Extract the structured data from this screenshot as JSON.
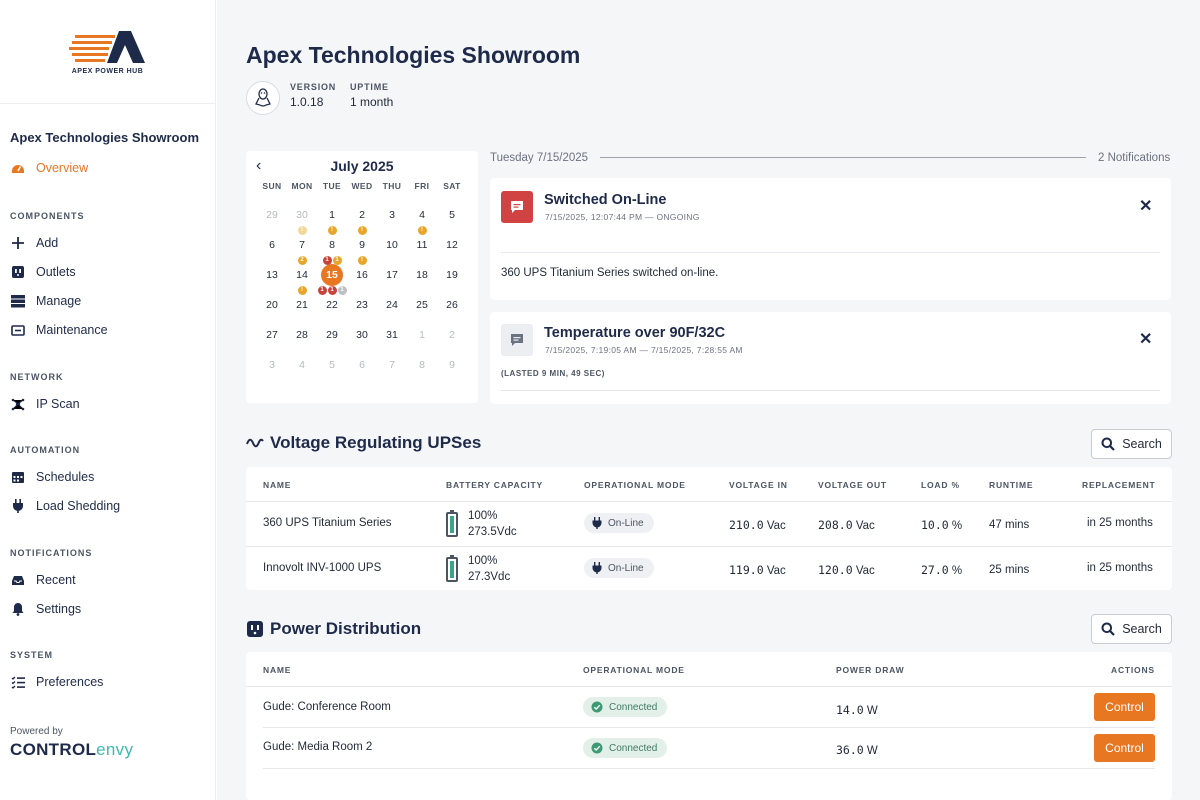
{
  "brand": {
    "logo_text": "APEX POWER HUB",
    "powered_by": "Powered by",
    "vendor_part1": "CONTROL",
    "vendor_part2": "envy",
    "accent_color": "#e87722"
  },
  "sidebar": {
    "site_name": "Apex Technologies Showroom",
    "overview": "Overview",
    "sections": {
      "components": "COMPONENTS",
      "network": "NETWORK",
      "automation": "AUTOMATION",
      "notifications": "NOTIFICATIONS",
      "system": "SYSTEM"
    },
    "items": {
      "add": "Add",
      "outlets": "Outlets",
      "manage": "Manage",
      "maintenance": "Maintenance",
      "ip_scan": "IP Scan",
      "schedules": "Schedules",
      "load_shedding": "Load Shedding",
      "recent": "Recent",
      "settings": "Settings",
      "preferences": "Preferences"
    }
  },
  "header": {
    "title": "Apex Technologies Showroom",
    "os_icon": "linux-icon",
    "version_label": "VERSION",
    "version": "1.0.18",
    "uptime_label": "UPTIME",
    "uptime": "1 month"
  },
  "calendar": {
    "month": "July 2025",
    "days_of_week": [
      "SUN",
      "MON",
      "TUE",
      "WED",
      "THU",
      "FRI",
      "SAT"
    ],
    "weeks": [
      [
        "29",
        "30",
        "1",
        "2",
        "3",
        "4",
        "5"
      ],
      [
        "6",
        "7",
        "8",
        "9",
        "10",
        "11",
        "12"
      ],
      [
        "13",
        "14",
        "15",
        "16",
        "17",
        "18",
        "19"
      ],
      [
        "20",
        "21",
        "22",
        "23",
        "24",
        "25",
        "26"
      ],
      [
        "27",
        "28",
        "29",
        "30",
        "31",
        "1",
        "2"
      ],
      [
        "3",
        "4",
        "5",
        "6",
        "7",
        "8",
        "9"
      ]
    ],
    "selected_day": "15",
    "markers": [
      {
        "week": 0,
        "day": 1,
        "dots": [
          {
            "color": "ly",
            "text": "!"
          }
        ]
      },
      {
        "week": 0,
        "day": 2,
        "dots": [
          {
            "color": "y",
            "text": "!"
          }
        ]
      },
      {
        "week": 0,
        "day": 3,
        "dots": [
          {
            "color": "y",
            "text": "!"
          }
        ]
      },
      {
        "week": 0,
        "day": 5,
        "dots": [
          {
            "color": "y",
            "text": "!"
          }
        ]
      },
      {
        "week": 1,
        "day": 1,
        "dots": [
          {
            "color": "y",
            "text": "2"
          }
        ]
      },
      {
        "week": 1,
        "day": 2,
        "dots": [
          {
            "color": "r",
            "text": "1"
          },
          {
            "color": "y",
            "text": "1"
          }
        ]
      },
      {
        "week": 1,
        "day": 3,
        "dots": [
          {
            "color": "y",
            "text": "!"
          }
        ]
      },
      {
        "week": 2,
        "day": 1,
        "dots": [
          {
            "color": "y",
            "text": "!"
          }
        ]
      },
      {
        "week": 2,
        "day": 2,
        "dots": [
          {
            "color": "r",
            "text": "1"
          },
          {
            "color": "r",
            "text": "1"
          },
          {
            "color": "g",
            "text": "1"
          }
        ]
      }
    ]
  },
  "notifications": {
    "date": "Tuesday 7/15/2025",
    "count": "2 Notifications",
    "items": [
      {
        "title": "Switched On-Line",
        "subtitle": "7/15/2025, 12:07:44 PM  —  ONGOING",
        "message": "360 UPS Titanium Series switched on-line.",
        "icon": "message-icon",
        "icon_color": "#d14343"
      },
      {
        "title": "Temperature over 90F/32C",
        "subtitle": "7/15/2025, 7:19:05 AM  —  7/15/2025, 7:28:55 AM",
        "lasted": "(LASTED 9 MIN, 49 SEC)",
        "icon": "message-icon",
        "icon_color": "#6b7280"
      }
    ]
  },
  "ups_section": {
    "title": "Voltage Regulating UPSes",
    "search_label": "Search",
    "columns": [
      "NAME",
      "BATTERY CAPACITY",
      "OPERATIONAL MODE",
      "VOLTAGE IN",
      "VOLTAGE OUT",
      "LOAD %",
      "RUNTIME",
      "REPLACEMENT"
    ],
    "rows": [
      {
        "name": "360 UPS Titanium Series",
        "battery_pct": "100%",
        "battery_v": "273.5Vdc",
        "mode": "On-Line",
        "vin": "210.0",
        "vin_unit": "Vac",
        "vout": "208.0",
        "vout_unit": "Vac",
        "load": "10.0",
        "load_unit": "%",
        "runtime": "47 mins",
        "replacement": "in 25 months"
      },
      {
        "name": "Innovolt INV-1000 UPS",
        "battery_pct": "100%",
        "battery_v": "27.3Vdc",
        "mode": "On-Line",
        "vin": "119.0",
        "vin_unit": "Vac",
        "vout": "120.0",
        "vout_unit": "Vac",
        "load": "27.0",
        "load_unit": "%",
        "runtime": "25 mins",
        "replacement": "in 25 months"
      }
    ]
  },
  "pdu_section": {
    "title": "Power Distribution",
    "search_label": "Search",
    "columns": [
      "NAME",
      "OPERATIONAL MODE",
      "POWER DRAW",
      "ACTIONS"
    ],
    "rows": [
      {
        "name": "Gude: Conference Room",
        "mode": "Connected",
        "power": "14.0",
        "power_unit": "W",
        "action": "Control"
      },
      {
        "name": "Gude: Media Room 2",
        "mode": "Connected",
        "power": "36.0",
        "power_unit": "W",
        "action": "Control"
      }
    ]
  }
}
